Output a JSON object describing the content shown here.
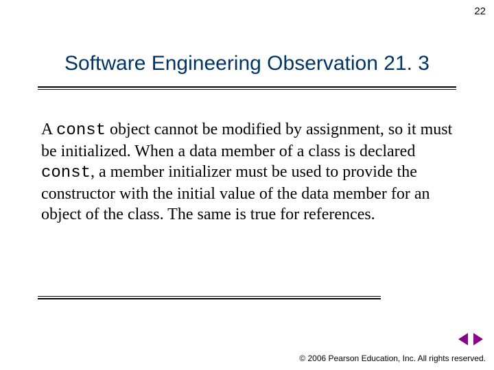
{
  "page_number": "22",
  "title": "Software Engineering Observation 21. 3",
  "body": {
    "t1": "A ",
    "kw1": "const",
    "t2": " object cannot be modified by assignment, so it must be initialized. When a data member of a class is declared ",
    "kw2": "const",
    "t3": ", a member initializer must be used to provide the constructor with the initial value of the data member for an object of the class. The same is true for references."
  },
  "copyright": "© 2006 Pearson Education, Inc.  All rights reserved."
}
